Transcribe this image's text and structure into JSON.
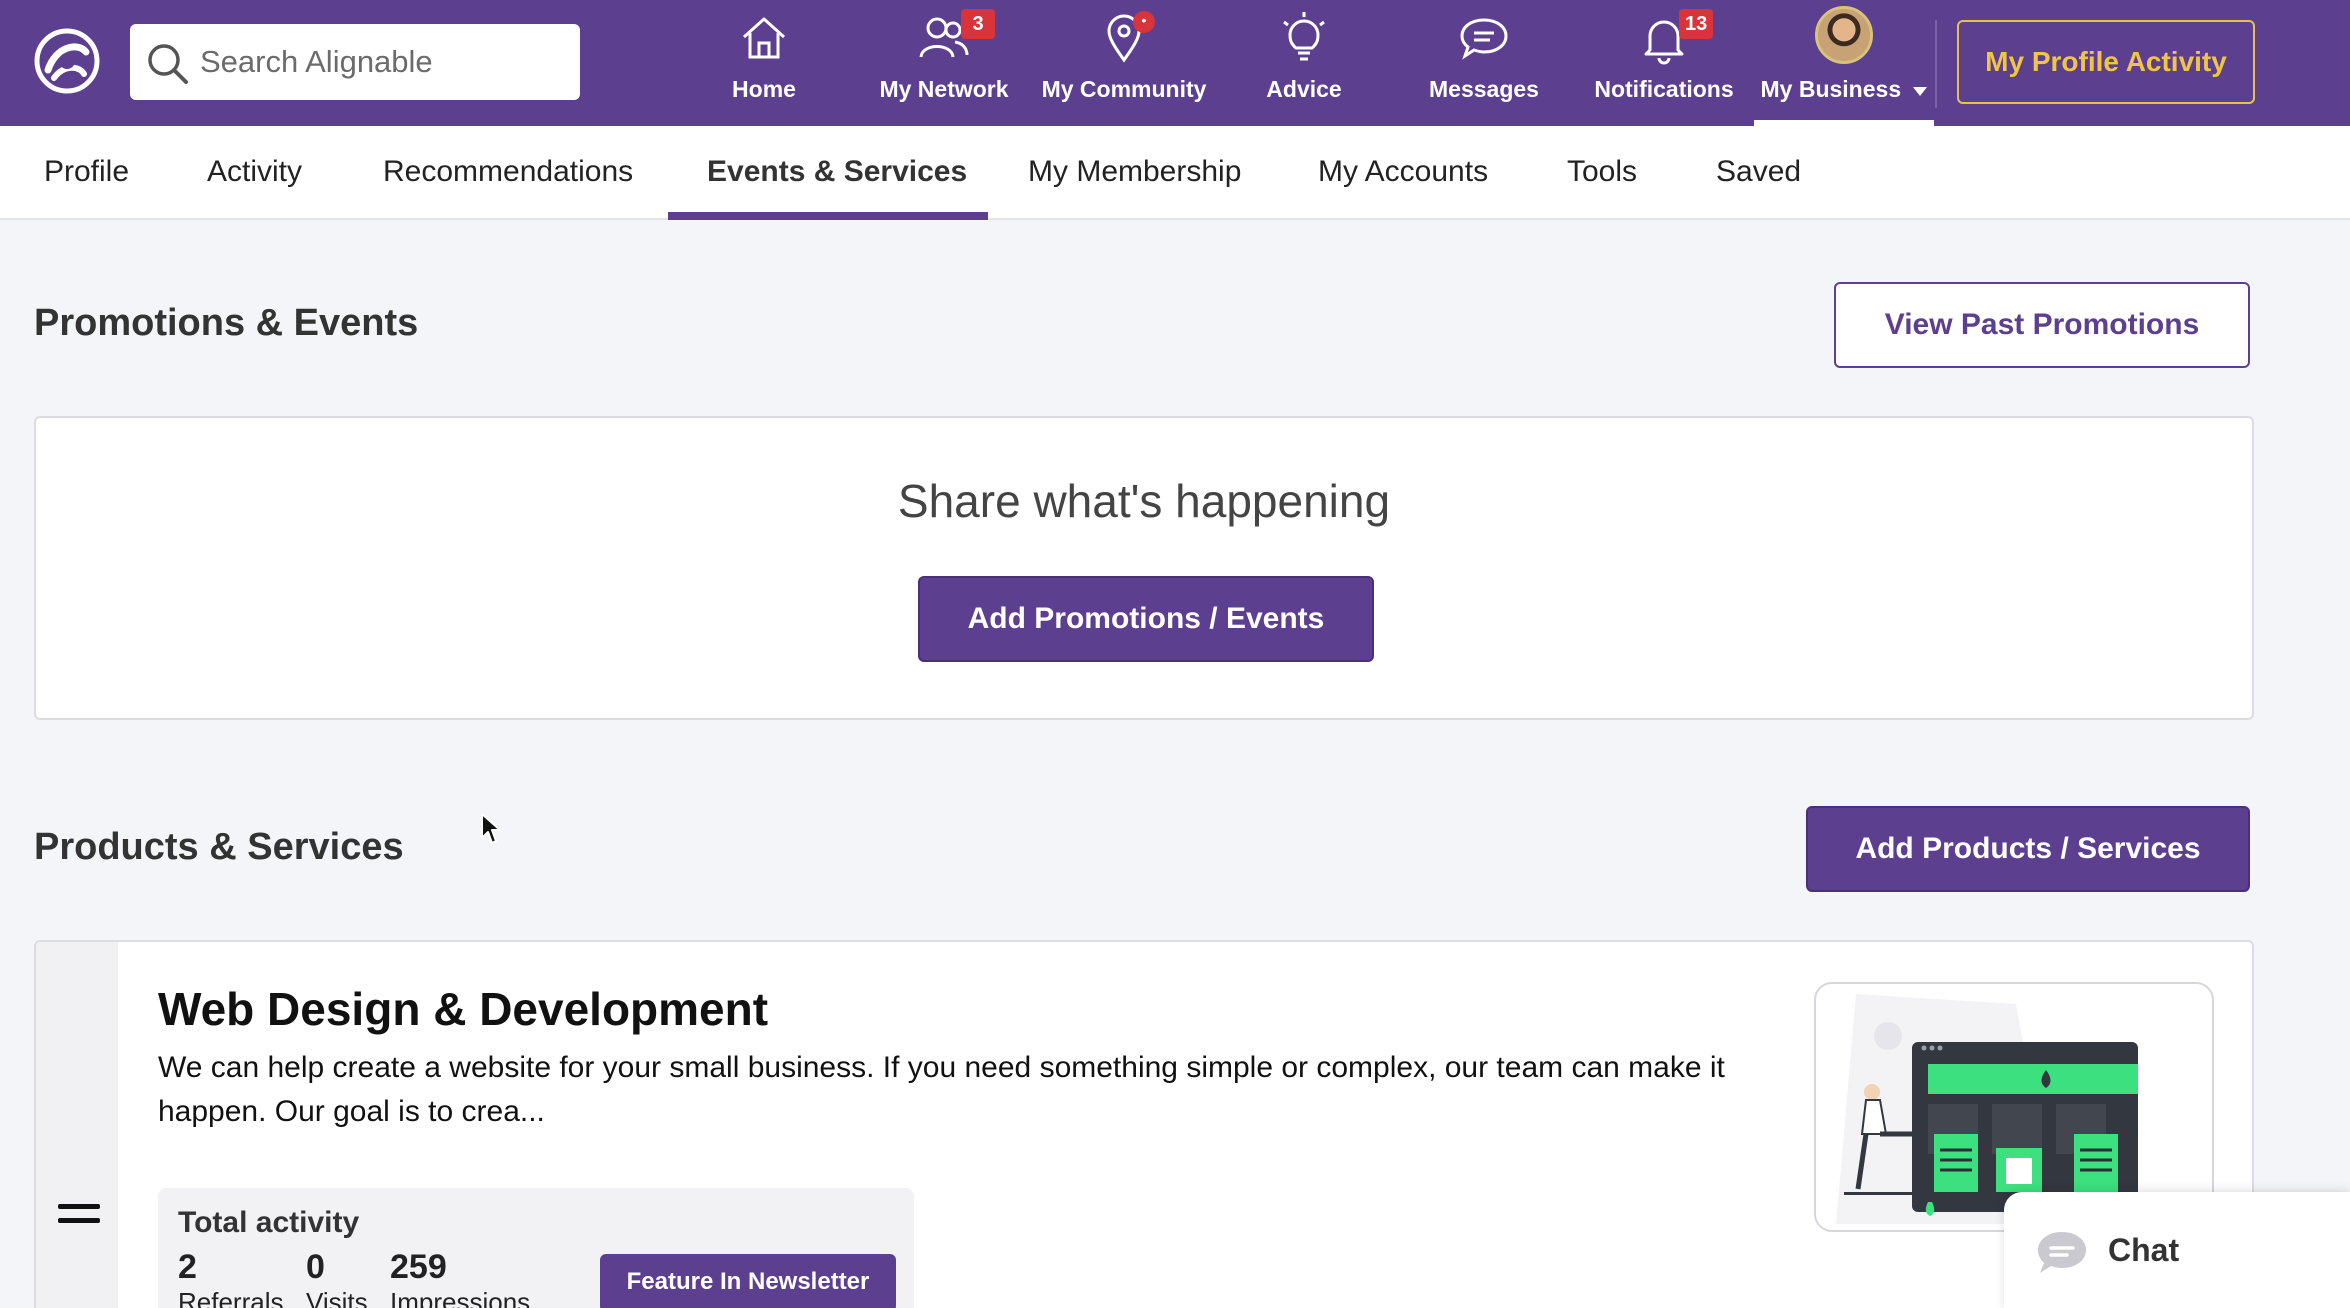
{
  "topbar": {
    "search_placeholder": "Search Alignable",
    "nav": [
      {
        "label": "Home",
        "icon": "home-icon"
      },
      {
        "label": "My Network",
        "icon": "network-icon",
        "badge": "3"
      },
      {
        "label": "My Community",
        "icon": "location-pin-icon",
        "badge": "•"
      },
      {
        "label": "Advice",
        "icon": "lightbulb-icon"
      },
      {
        "label": "Messages",
        "icon": "chat-bubble-icon"
      },
      {
        "label": "Notifications",
        "icon": "bell-icon",
        "badge": "13"
      },
      {
        "label": "My Business",
        "icon": "avatar"
      }
    ],
    "profile_activity_label": "My Profile Activity",
    "accent_color": "#5c3f8f",
    "highlight_color": "#f0c545"
  },
  "tabs": [
    "Profile",
    "Activity",
    "Recommendations",
    "Events & Services",
    "My Membership",
    "My Accounts",
    "Tools",
    "Saved"
  ],
  "active_tab": "Events & Services",
  "promotions": {
    "title": "Promotions & Events",
    "view_past_label": "View Past Promotions",
    "share_text": "Share what's happening",
    "add_label": "Add Promotions / Events"
  },
  "products": {
    "title": "Products & Services",
    "add_label": "Add Products / Services",
    "item": {
      "title": "Web Design & Development",
      "description": "We can help create a website for your small business. If you need something simple or complex, our team can make it happen. Our goal is to crea...",
      "activity_title": "Total activity",
      "stats": [
        {
          "num": "2",
          "label": "Referrals"
        },
        {
          "num": "0",
          "label": "Visits"
        },
        {
          "num": "259",
          "label": "Impressions"
        }
      ],
      "feature_label": "Feature In Newsletter"
    }
  },
  "chat": {
    "label": "Chat"
  }
}
